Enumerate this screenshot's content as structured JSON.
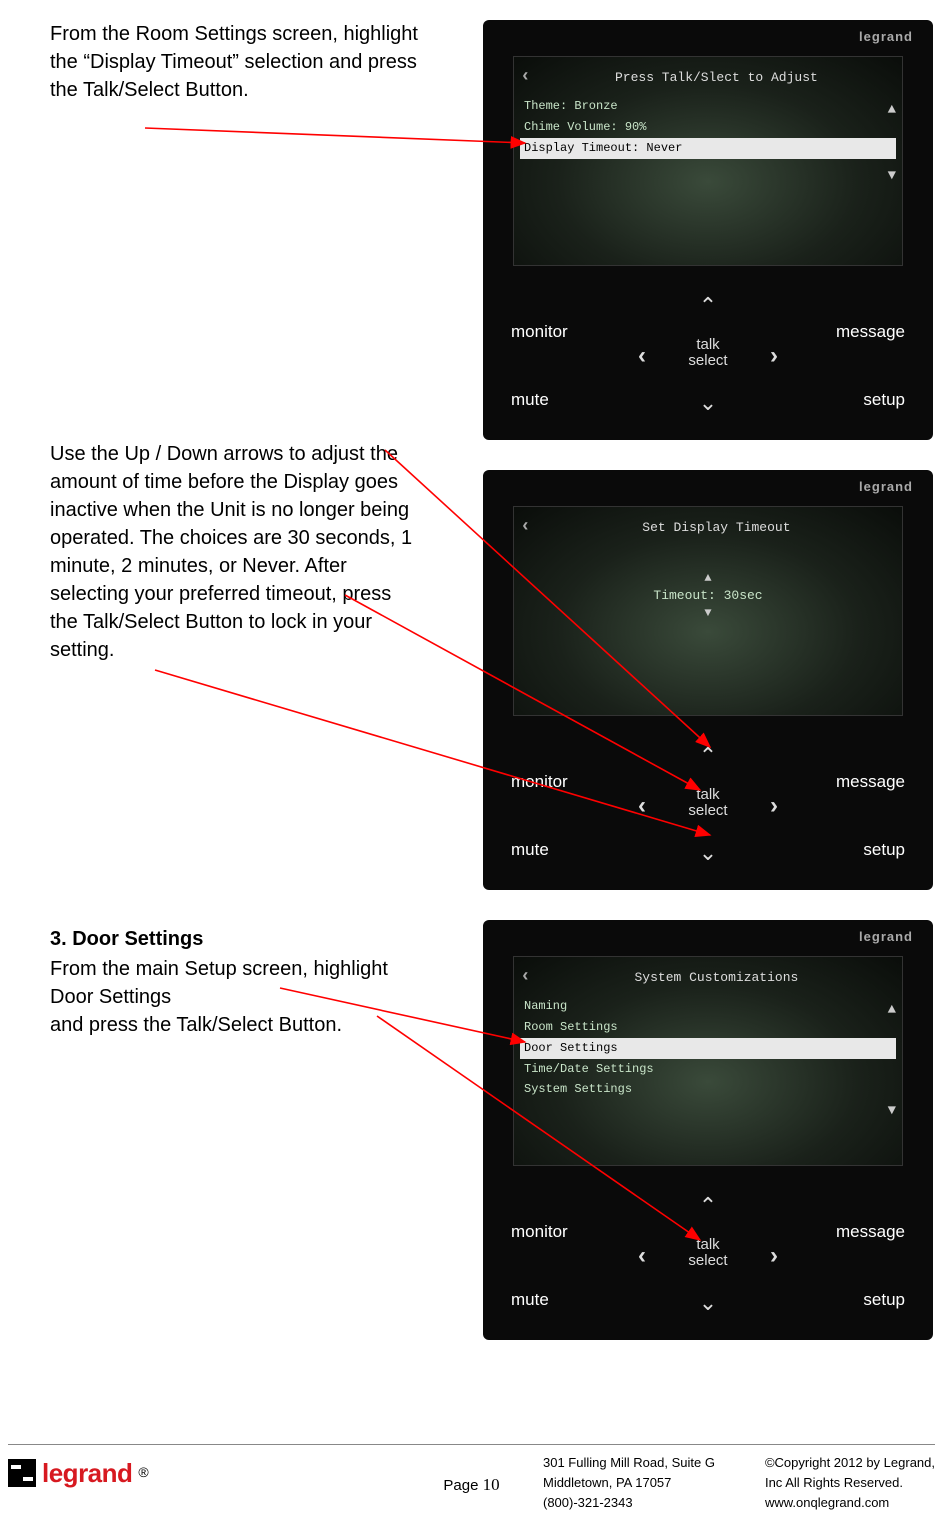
{
  "instructions": {
    "step1": "From the Room Settings screen, highlight the “Display Timeout” selection and press the Talk/Select Button.",
    "step2": "Use the Up / Down arrows to adjust the amount of time before the Display goes inactive when the Unit is no longer being operated. The choices are 30 seconds, 1 minute, 2 minutes, or Never. After selecting your preferred timeout, press the Talk/Select Button to lock in your setting.",
    "step3_heading": "3. Door Settings",
    "step3a": "From the main Setup screen, highlight Door Settings",
    "step3b": "and press the Talk/Select Button."
  },
  "device": {
    "brand": "legrand",
    "nav": {
      "monitor": "monitor",
      "mute": "mute",
      "message": "message",
      "setup": "setup",
      "center_top": "talk",
      "center_bottom": "select"
    },
    "screen1": {
      "title": "Press Talk/Slect to Adjust",
      "items": [
        "Theme: Bronze",
        "Chime Volume: 90%",
        "Display Timeout: Never"
      ],
      "highlightIndex": 2
    },
    "screen2": {
      "title": "Set Display Timeout",
      "value": "Timeout: 30sec"
    },
    "screen3": {
      "title": "System Customizations",
      "items": [
        "Naming",
        "Room Settings",
        "Door Settings",
        "Time/Date Settings",
        "System Settings"
      ],
      "highlightIndex": 2
    }
  },
  "footer": {
    "logo": "legrand",
    "page_label": "Page ",
    "page_number": "10",
    "addr1": "301 Fulling Mill Road, Suite G",
    "addr2": "Middletown, PA   17057",
    "addr3": "(800)-321-2343",
    "copy1": "©Copyright 2012 by Legrand,",
    "copy2": "Inc All Rights Reserved.",
    "copy3": "www.onqlegrand.com"
  }
}
